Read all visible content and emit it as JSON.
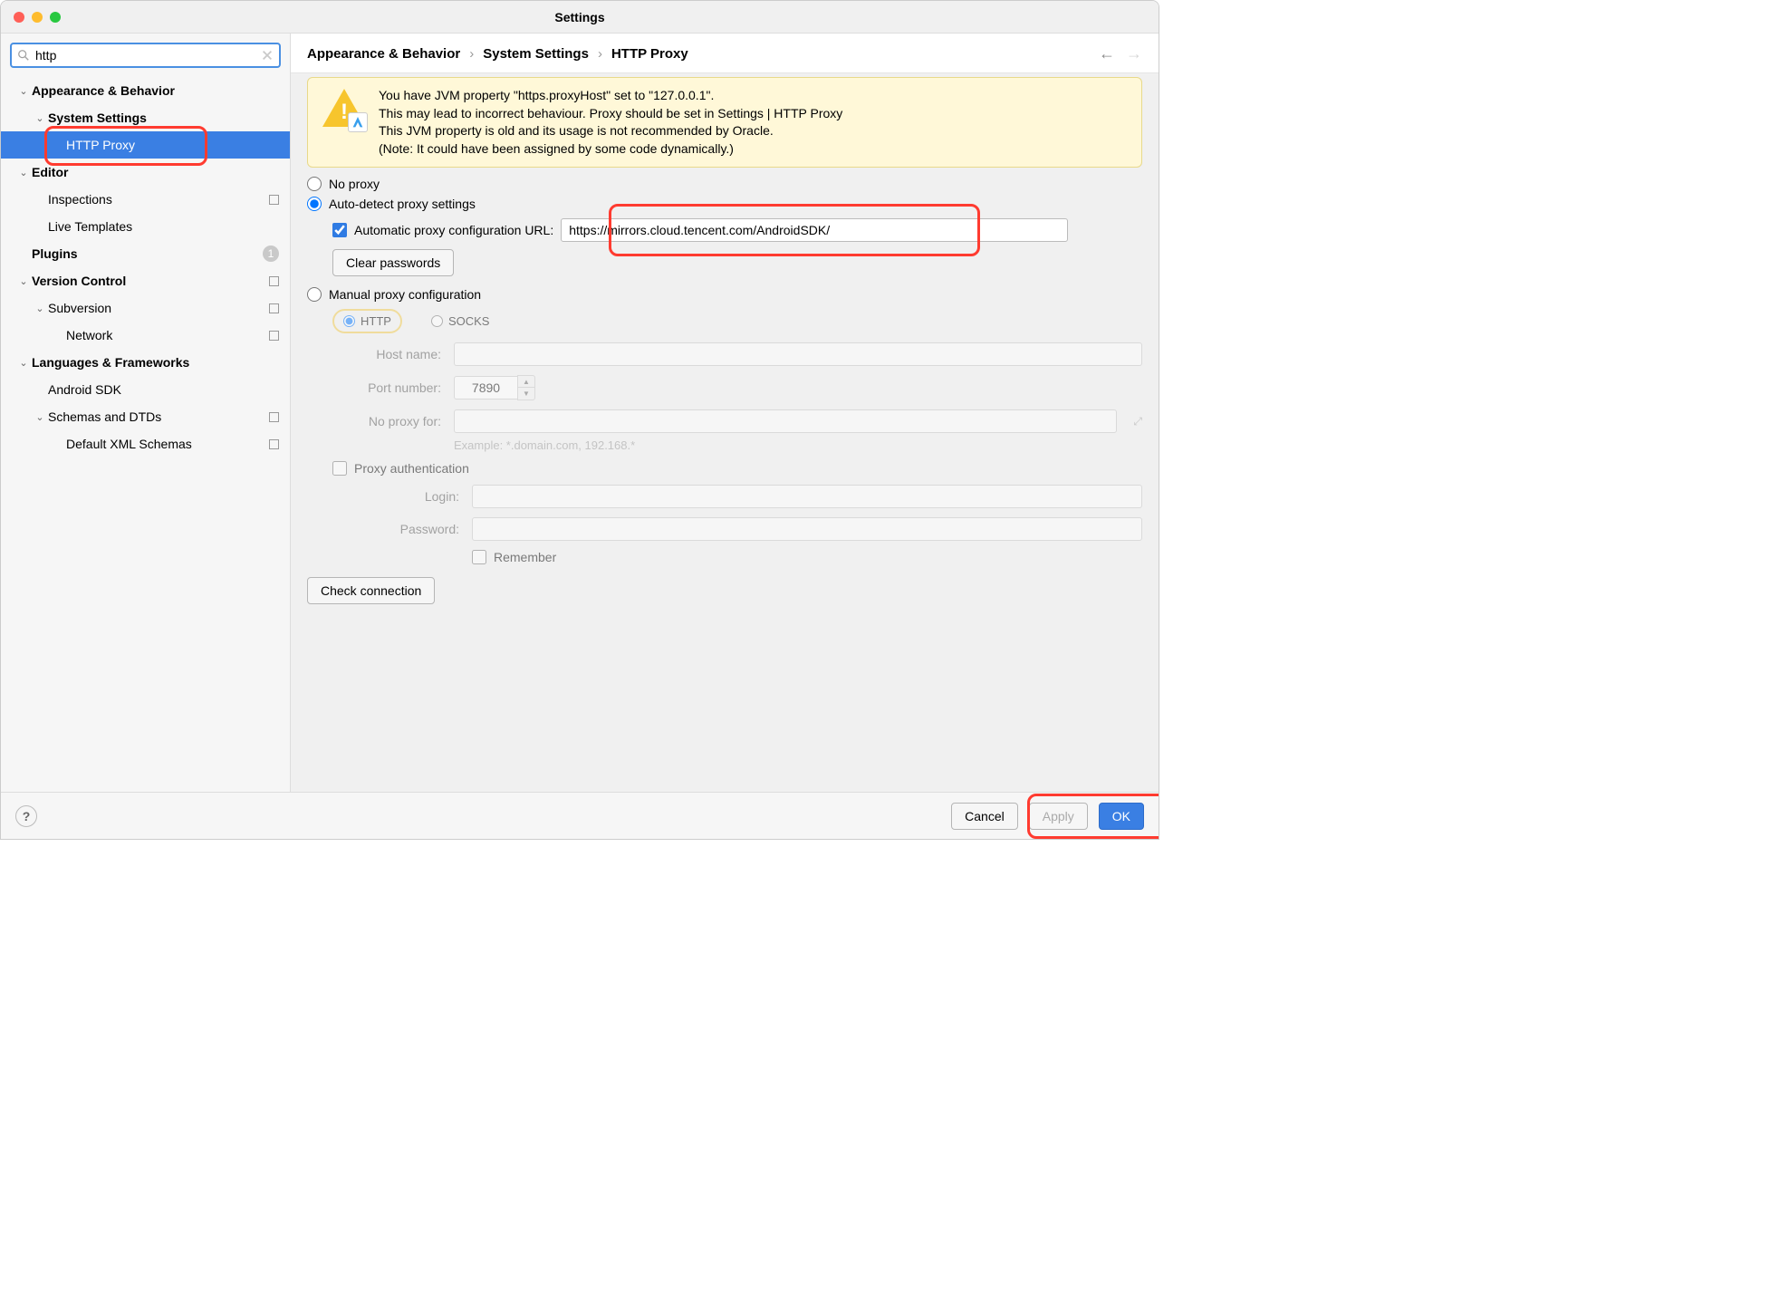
{
  "window": {
    "title": "Settings"
  },
  "search": {
    "value": "http"
  },
  "tree": {
    "items": [
      {
        "id": "appearance",
        "label": "Appearance & Behavior",
        "depth": 0,
        "arrow": "down",
        "bold": true
      },
      {
        "id": "system-settings",
        "label": "System Settings",
        "depth": 1,
        "arrow": "down",
        "bold": true
      },
      {
        "id": "http-proxy",
        "label": "HTTP Proxy",
        "depth": 2,
        "selected": true,
        "red": true
      },
      {
        "id": "editor",
        "label": "Editor",
        "depth": 0,
        "arrow": "down",
        "bold": true
      },
      {
        "id": "inspections",
        "label": "Inspections",
        "depth": 1,
        "box": true
      },
      {
        "id": "live-templates",
        "label": "Live Templates",
        "depth": 1
      },
      {
        "id": "plugins",
        "label": "Plugins",
        "depth": 0,
        "bold": true,
        "badge": "1"
      },
      {
        "id": "version-control",
        "label": "Version Control",
        "depth": 0,
        "arrow": "down",
        "bold": true,
        "box": true
      },
      {
        "id": "subversion",
        "label": "Subversion",
        "depth": 1,
        "arrow": "down",
        "box": true
      },
      {
        "id": "network",
        "label": "Network",
        "depth": 2,
        "box": true
      },
      {
        "id": "langs",
        "label": "Languages & Frameworks",
        "depth": 0,
        "arrow": "down",
        "bold": true
      },
      {
        "id": "android-sdk",
        "label": "Android SDK",
        "depth": 1
      },
      {
        "id": "schemas",
        "label": "Schemas and DTDs",
        "depth": 1,
        "arrow": "down",
        "box": true
      },
      {
        "id": "default-xml",
        "label": "Default XML Schemas",
        "depth": 2,
        "box": true
      }
    ]
  },
  "breadcrumb": [
    "Appearance & Behavior",
    "System Settings",
    "HTTP Proxy"
  ],
  "warning": {
    "line1": "You have JVM property \"https.proxyHost\" set to \"127.0.0.1\".",
    "line2": "This may lead to incorrect behaviour. Proxy should be set in Settings | HTTP Proxy",
    "line3": "This JVM property is old and its usage is not recommended by Oracle.",
    "line4": "(Note: It could have been assigned by some code dynamically.)"
  },
  "proxy": {
    "no_proxy": "No proxy",
    "auto_detect": "Auto-detect proxy settings",
    "pac_label": "Automatic proxy configuration URL:",
    "pac_url": "https://mirrors.cloud.tencent.com/AndroidSDK/",
    "clear_passwords": "Clear passwords",
    "manual": "Manual proxy configuration",
    "http": "HTTP",
    "socks": "SOCKS",
    "host_label": "Host name:",
    "port_label": "Port number:",
    "port_value": "7890",
    "no_proxy_for_label": "No proxy for:",
    "example": "Example: *.domain.com, 192.168.*",
    "auth_label": "Proxy authentication",
    "login_label": "Login:",
    "password_label": "Password:",
    "remember": "Remember",
    "check_connection": "Check connection"
  },
  "footer": {
    "cancel": "Cancel",
    "apply": "Apply",
    "ok": "OK"
  }
}
